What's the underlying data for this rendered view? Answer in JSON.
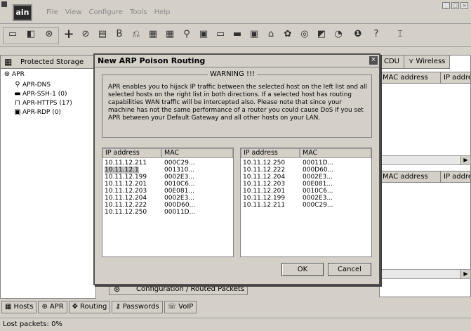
{
  "app": {
    "logo_text": "ain",
    "menu": [
      "File",
      "View",
      "Configure",
      "Tools",
      "Help"
    ]
  },
  "left_panel": {
    "header": "Protected Storage",
    "tree": [
      {
        "label": "APR",
        "icon": "apr-icon"
      },
      {
        "label": "APR-DNS",
        "icon": "dns-icon"
      },
      {
        "label": "APR-SSH-1 (0)",
        "icon": "ssh-icon"
      },
      {
        "label": "APR-HTTPS (17)",
        "icon": "lock-icon"
      },
      {
        "label": "APR-RDP (0)",
        "icon": "rdp-icon"
      }
    ]
  },
  "right_panel": {
    "tabs": [
      "CDU",
      "Wireless"
    ],
    "columns": [
      "MAC address",
      "IP addre"
    ]
  },
  "config_tab": "Configuration / Routed Packets",
  "bottom_tabs": [
    "Hosts",
    "APR",
    "Routing",
    "Passwords",
    "VoIP"
  ],
  "status": "Lost packets:  0%",
  "dialog": {
    "title": "New ARP Poison Routing",
    "warning_title": "WARNING !!!",
    "warning_text": "APR enables you to hijack IP traffic between the selected host on the left list and all selected hosts on the right list in both directions. If a selected host has routing capabilities WAN traffic will be intercepted also. Please note that since your machine has not the same performance of a router you could cause DoS if you set APR between your Default Gateway and all other hosts on your LAN.",
    "columns": [
      "IP address",
      "MAC"
    ],
    "left_list": [
      {
        "ip": "10.11.12.211",
        "mac": "000C29..."
      },
      {
        "ip": "10.11.12.1",
        "mac": "001310..."
      },
      {
        "ip": "10.11.12.199",
        "mac": "0002E3..."
      },
      {
        "ip": "10.11.12.201",
        "mac": "0010C6..."
      },
      {
        "ip": "10.11.12.203",
        "mac": "00E081..."
      },
      {
        "ip": "10.11.12.204",
        "mac": "0002E3..."
      },
      {
        "ip": "10.11.12.222",
        "mac": "000D60..."
      },
      {
        "ip": "10.11.12.250",
        "mac": "00011D..."
      }
    ],
    "right_list": [
      {
        "ip": "10.11.12.250",
        "mac": "00011D..."
      },
      {
        "ip": "10.11.12.222",
        "mac": "000D60..."
      },
      {
        "ip": "10.11.12.204",
        "mac": "0002E3..."
      },
      {
        "ip": "10.11.12.203",
        "mac": "00E081..."
      },
      {
        "ip": "10.11.12.201",
        "mac": "0010C6..."
      },
      {
        "ip": "10.11.12.199",
        "mac": "0002E3..."
      },
      {
        "ip": "10.11.12.211",
        "mac": "000C29..."
      }
    ],
    "selected_left": "10.11.12.1",
    "ok_label": "OK",
    "cancel_label": "Cancel"
  }
}
